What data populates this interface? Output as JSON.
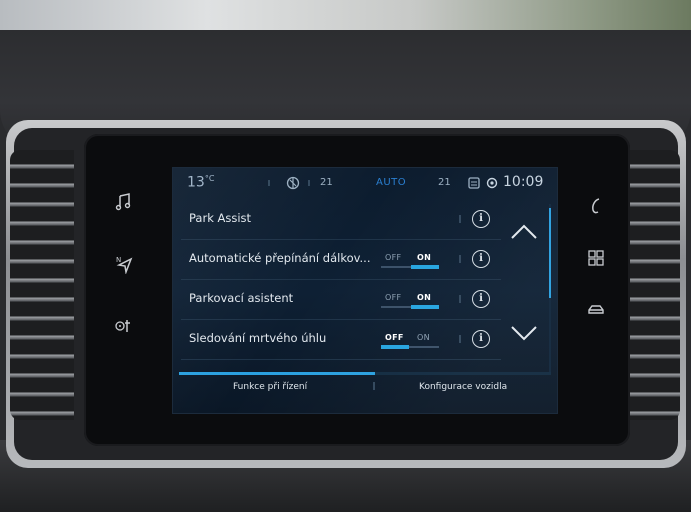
{
  "status_bar": {
    "temp_left": "13",
    "temp_unit": "°C",
    "fan_level": "21",
    "climate_mode": "AUTO",
    "temp_right": "21",
    "time": "10:09"
  },
  "settings_list": [
    {
      "label": "Park Assist",
      "has_toggle": false
    },
    {
      "label": "Automatické přepínání dálkov...",
      "has_toggle": true,
      "off_label": "OFF",
      "on_label": "ON",
      "state": "ON"
    },
    {
      "label": "Parkovací asistent",
      "has_toggle": true,
      "off_label": "OFF",
      "on_label": "ON",
      "state": "ON"
    },
    {
      "label": "Sledování mrtvého úhlu",
      "has_toggle": true,
      "off_label": "OFF",
      "on_label": "ON",
      "state": "OFF"
    }
  ],
  "info_glyph": "i",
  "tabs": [
    {
      "label": "Funkce při řízení",
      "active": true
    },
    {
      "label": "Konfigurace vozidla",
      "active": false
    }
  ],
  "side_buttons_left": [
    "music-icon",
    "navigation-icon",
    "climate-fan-icon"
  ],
  "side_buttons_right": [
    "phone-icon",
    "apps-grid-icon",
    "car-icon"
  ],
  "colors": {
    "accent": "#25a4e0",
    "auto": "#2a7fd0",
    "screen_bg": "#0c1c2e"
  }
}
